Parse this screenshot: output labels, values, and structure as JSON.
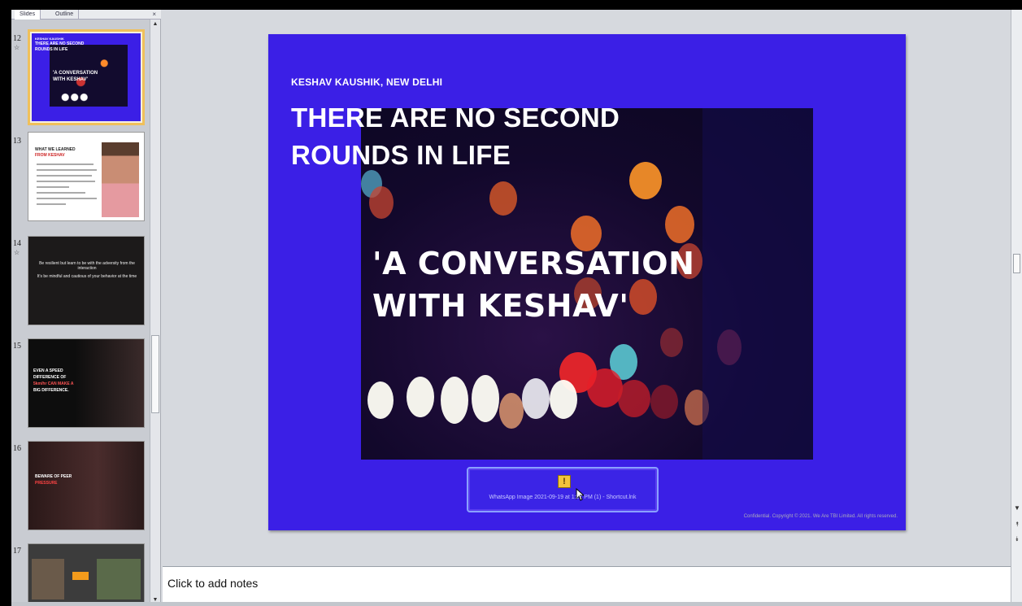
{
  "panel": {
    "tabs": [
      "Slides",
      "Outline"
    ],
    "close_glyph": "×"
  },
  "thumbnails": [
    {
      "number": "12",
      "mark": "☆",
      "lines": [
        "KESHAV KAUSHIK",
        "THERE ARE NO SECOND",
        "ROUNDS IN LIFE",
        "'A CONVERSATION",
        "WITH KESHAV'"
      ]
    },
    {
      "number": "13",
      "lines": [
        "WHAT WE LEARNED",
        "FROM KESHAV"
      ]
    },
    {
      "number": "14",
      "mark": "☆",
      "lines": [
        "Be resilient but learn to be with the adversity from the interaction",
        "It's be mindful and cautious of your behavior at the time"
      ]
    },
    {
      "number": "15",
      "lines": [
        "EVEN A SPEED",
        "DIFFERENCE OF",
        "5km/hr CAN MAKE A",
        "BIG DIFFERENCE."
      ]
    },
    {
      "number": "16",
      "lines": [
        "BEWARE OF PEER",
        "PRESSURE"
      ]
    },
    {
      "number": "17",
      "lines": []
    }
  ],
  "slide": {
    "author": "KESHAV KAUSHIK, NEW DELHI",
    "title_line1": "THERE ARE NO SECOND",
    "title_line2": "ROUNDS IN LIFE",
    "subtitle_line1": "'A CONVERSATION",
    "subtitle_line2": "WITH KESHAV'",
    "footer": "Confidential. Copyright © 2021. We Are TBI Limited. All rights reserved.",
    "background_color": "#3b1fe6"
  },
  "toast": {
    "icon": "warning-icon",
    "text": "WhatsApp Image 2021-09-19 at 1:27 PM (1) - Shortcut.lnk"
  },
  "notes": {
    "placeholder": "Click to add notes"
  },
  "scroll": {
    "up": "▲",
    "down": "▼",
    "prev": "⯭",
    "next": "⯯"
  }
}
